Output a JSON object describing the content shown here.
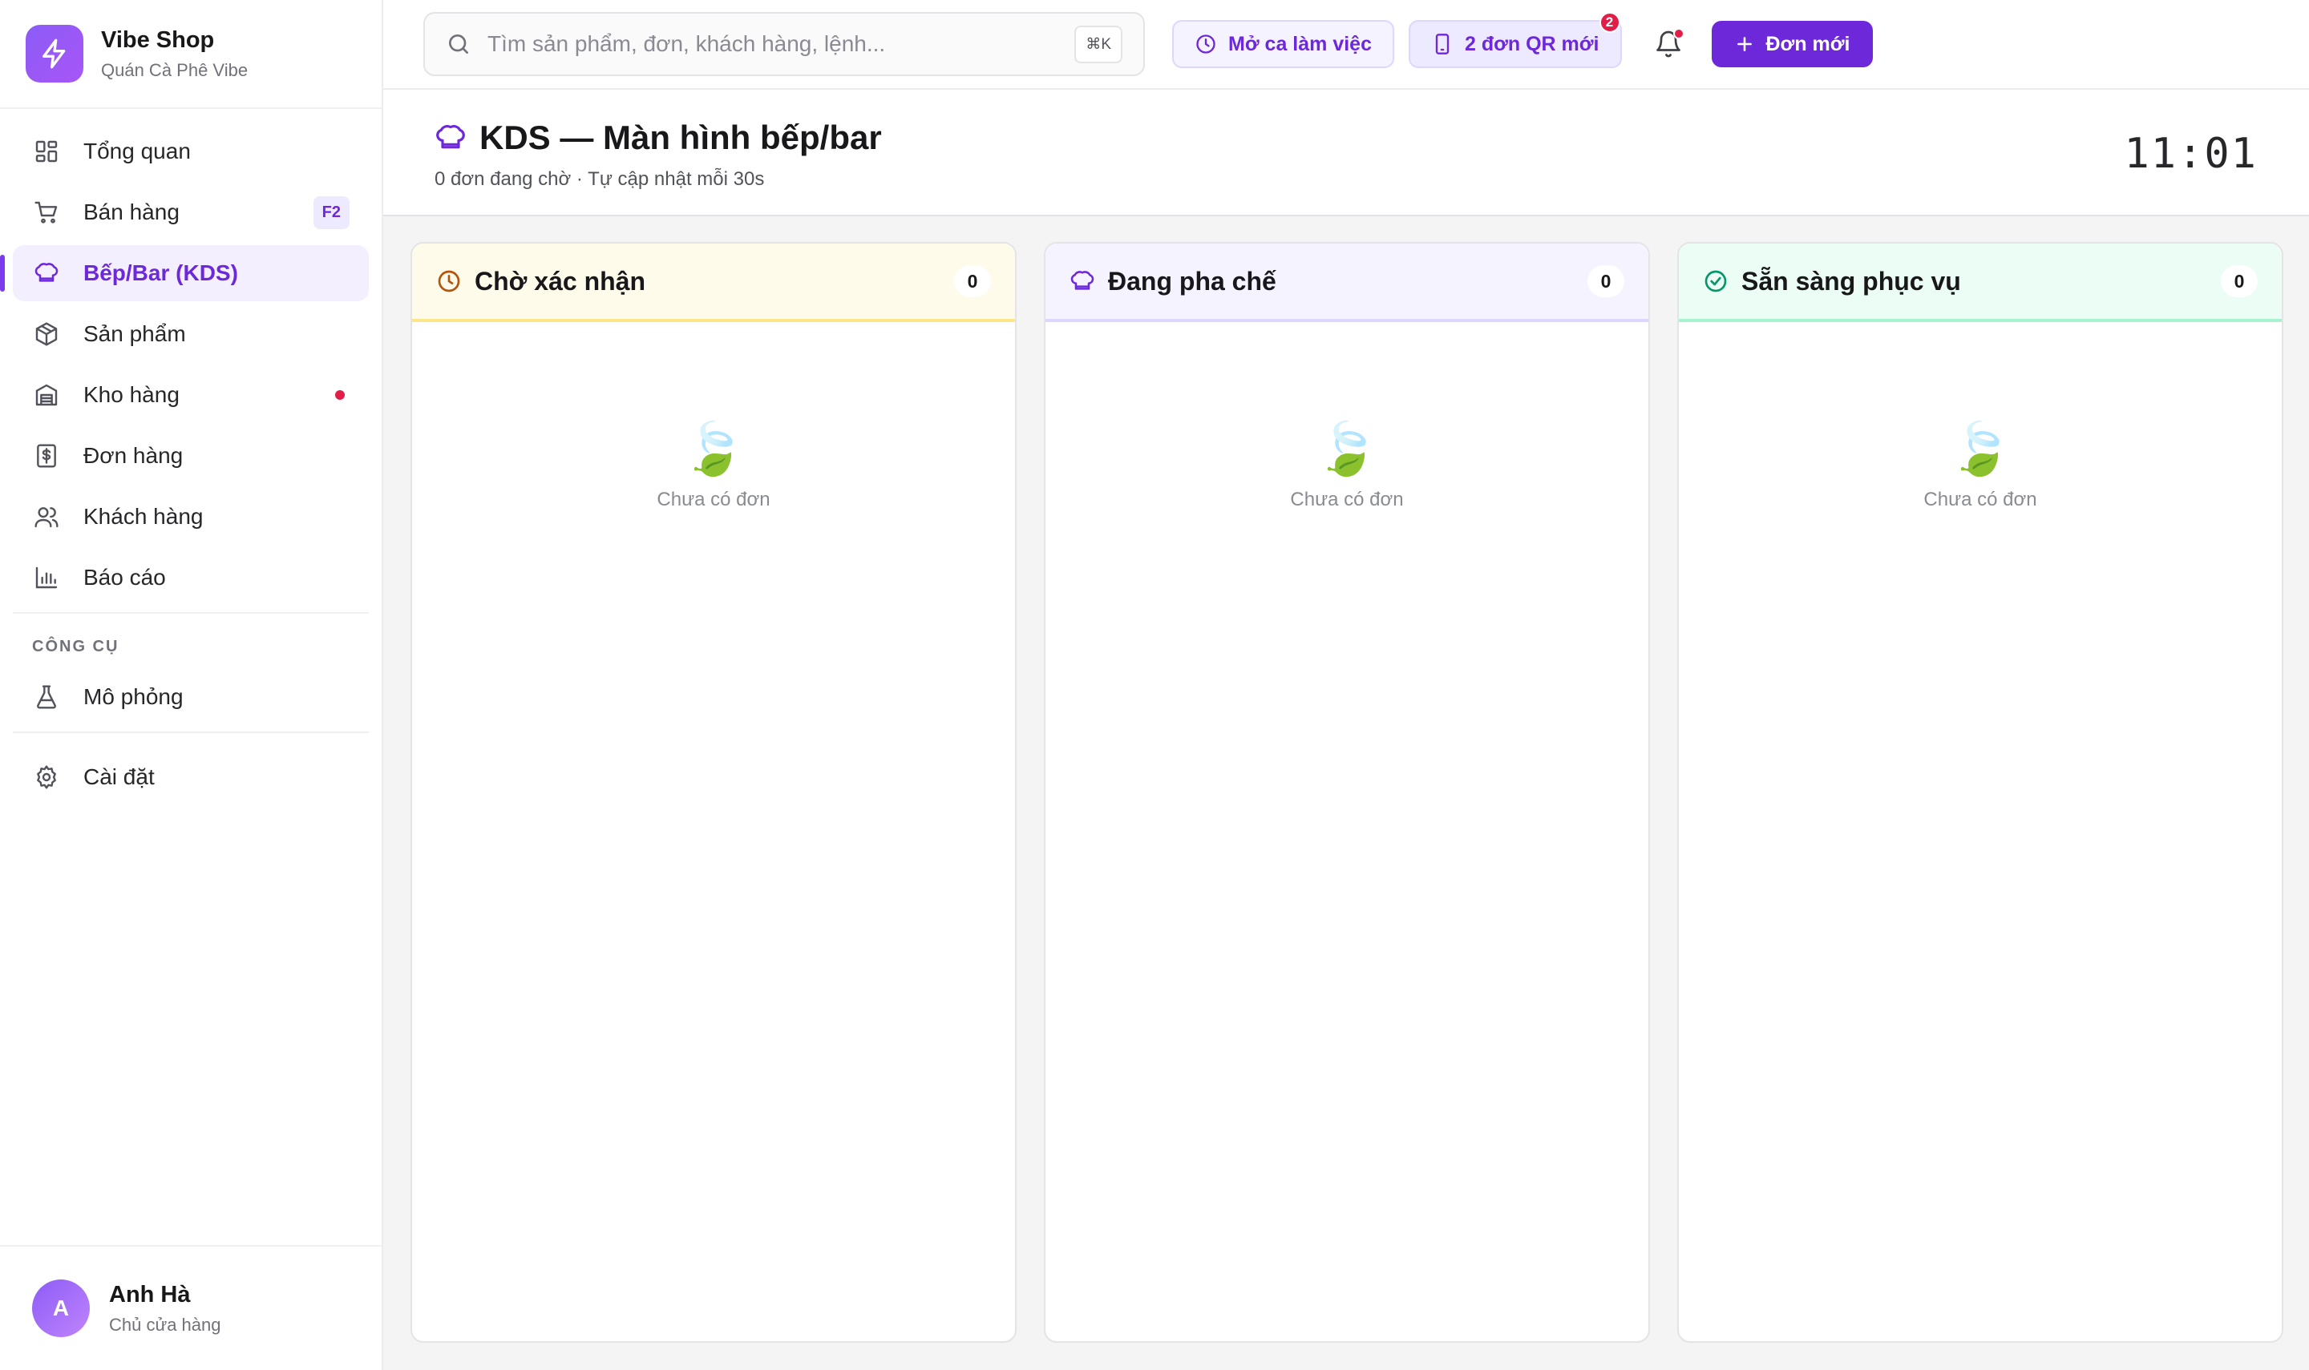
{
  "brand": {
    "name": "Vibe Shop",
    "subtitle": "Quán Cà Phê Vibe"
  },
  "nav": {
    "items": [
      {
        "label": "Tổng quan",
        "icon": "dashboard-icon"
      },
      {
        "label": "Bán hàng",
        "icon": "cart-icon",
        "badge": "F2"
      },
      {
        "label": "Bếp/Bar (KDS)",
        "icon": "chef-hat-icon",
        "active": true
      },
      {
        "label": "Sản phẩm",
        "icon": "box-icon"
      },
      {
        "label": "Kho hàng",
        "icon": "warehouse-icon",
        "dot": true
      },
      {
        "label": "Đơn hàng",
        "icon": "receipt-icon"
      },
      {
        "label": "Khách hàng",
        "icon": "users-icon"
      },
      {
        "label": "Báo cáo",
        "icon": "bar-chart-icon"
      }
    ],
    "tools_label": "CÔNG CỤ",
    "tools": [
      {
        "label": "Mô phỏng",
        "icon": "flask-icon"
      }
    ],
    "settings": {
      "label": "Cài đặt",
      "icon": "gear-icon"
    }
  },
  "user": {
    "initial": "A",
    "name": "Anh Hà",
    "role": "Chủ cửa hàng"
  },
  "topbar": {
    "search_placeholder": "Tìm sản phẩm, đơn, khách hàng, lệnh...",
    "search_shortcut": "⌘K",
    "shift_label": "Mở ca làm việc",
    "qr_label": "2 đơn QR mới",
    "qr_badge": "2",
    "new_order_label": "Đơn mới"
  },
  "page": {
    "title": "KDS — Màn hình bếp/bar",
    "subtitle": "0 đơn đang chờ · Tự cập nhật mỗi 30s",
    "clock": "11:01"
  },
  "columns": [
    {
      "title": "Chờ xác nhận",
      "count": "0",
      "empty_text": "Chưa có đơn",
      "empty_icon": "🍃",
      "accent": "#fde68a"
    },
    {
      "title": "Đang pha chế",
      "count": "0",
      "empty_text": "Chưa có đơn",
      "empty_icon": "🍃",
      "accent": "#ddd6fe"
    },
    {
      "title": "Sẵn sàng phục vụ",
      "count": "0",
      "empty_text": "Chưa có đơn",
      "empty_icon": "🍃",
      "accent": "#a7f3d0"
    }
  ],
  "colors": {
    "accent": "#6d28d9",
    "alert": "#e11d48"
  }
}
